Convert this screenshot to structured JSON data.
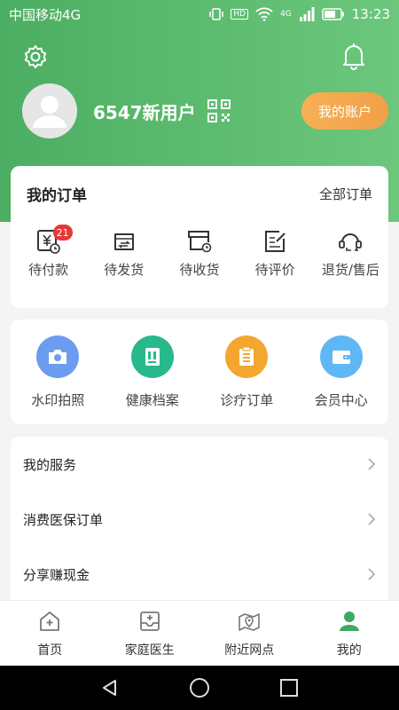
{
  "status_bar": {
    "carrier": "中国移动4G",
    "time": "13:23",
    "hd": "HD",
    "net": "4G"
  },
  "header": {
    "username": "6547新用户",
    "account_button": "我的账户"
  },
  "orders": {
    "title": "我的订单",
    "all_label": "全部订单",
    "items": [
      {
        "label": "待付款",
        "icon": "payment-icon",
        "badge": "21"
      },
      {
        "label": "待发货",
        "icon": "shipping-icon"
      },
      {
        "label": "待收货",
        "icon": "receive-icon"
      },
      {
        "label": "待评价",
        "icon": "review-icon"
      },
      {
        "label": "退货/售后",
        "icon": "aftersale-icon"
      }
    ]
  },
  "quick": [
    {
      "label": "水印拍照",
      "icon": "camera-icon",
      "color": "#6b9cf0"
    },
    {
      "label": "健康档案",
      "icon": "file-icon",
      "color": "#27b98b"
    },
    {
      "label": "诊疗订单",
      "icon": "clipboard-icon",
      "color": "#f3a72e"
    },
    {
      "label": "会员中心",
      "icon": "wallet-icon",
      "color": "#5fb8f3"
    }
  ],
  "services": [
    {
      "label": "我的服务"
    },
    {
      "label": "消费医保订单"
    },
    {
      "label": "分享赚现金"
    }
  ],
  "tabs": [
    {
      "label": "首页",
      "icon": "home-icon"
    },
    {
      "label": "家庭医生",
      "icon": "doctor-icon"
    },
    {
      "label": "附近网点",
      "icon": "location-icon"
    },
    {
      "label": "我的",
      "icon": "user-icon",
      "active": true
    }
  ],
  "colors": {
    "brand": "#4cae62",
    "accent": "#f0a049",
    "badge": "#e53935"
  }
}
